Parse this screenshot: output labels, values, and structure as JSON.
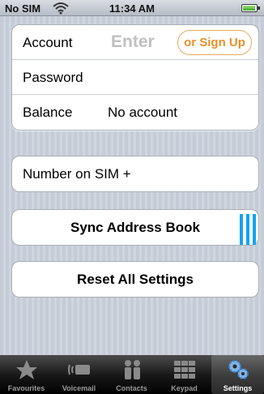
{
  "status_bar": {
    "carrier": "No SIM",
    "time": "11:34 AM"
  },
  "account_group": {
    "account_label": "Account",
    "account_placeholder": "Enter",
    "signup_label": "or Sign Up",
    "password_label": "Password",
    "balance_label": "Balance",
    "balance_value": "No account"
  },
  "number_on_sim": "Number on SIM +",
  "sync_button": "Sync Address Book",
  "reset_button": "Reset All Settings",
  "tab_bar": {
    "tabs": [
      {
        "label": "Favourites",
        "icon": "star-icon"
      },
      {
        "label": "Voicemail",
        "icon": "voicemail-icon"
      },
      {
        "label": "Contacts",
        "icon": "contacts-icon"
      },
      {
        "label": "Keypad",
        "icon": "keypad-icon"
      },
      {
        "label": "Settings",
        "icon": "settings-gears-icon"
      }
    ],
    "active": "Settings"
  },
  "colors": {
    "signup": "#e8902a",
    "selection_marks": "#11a4f2"
  }
}
